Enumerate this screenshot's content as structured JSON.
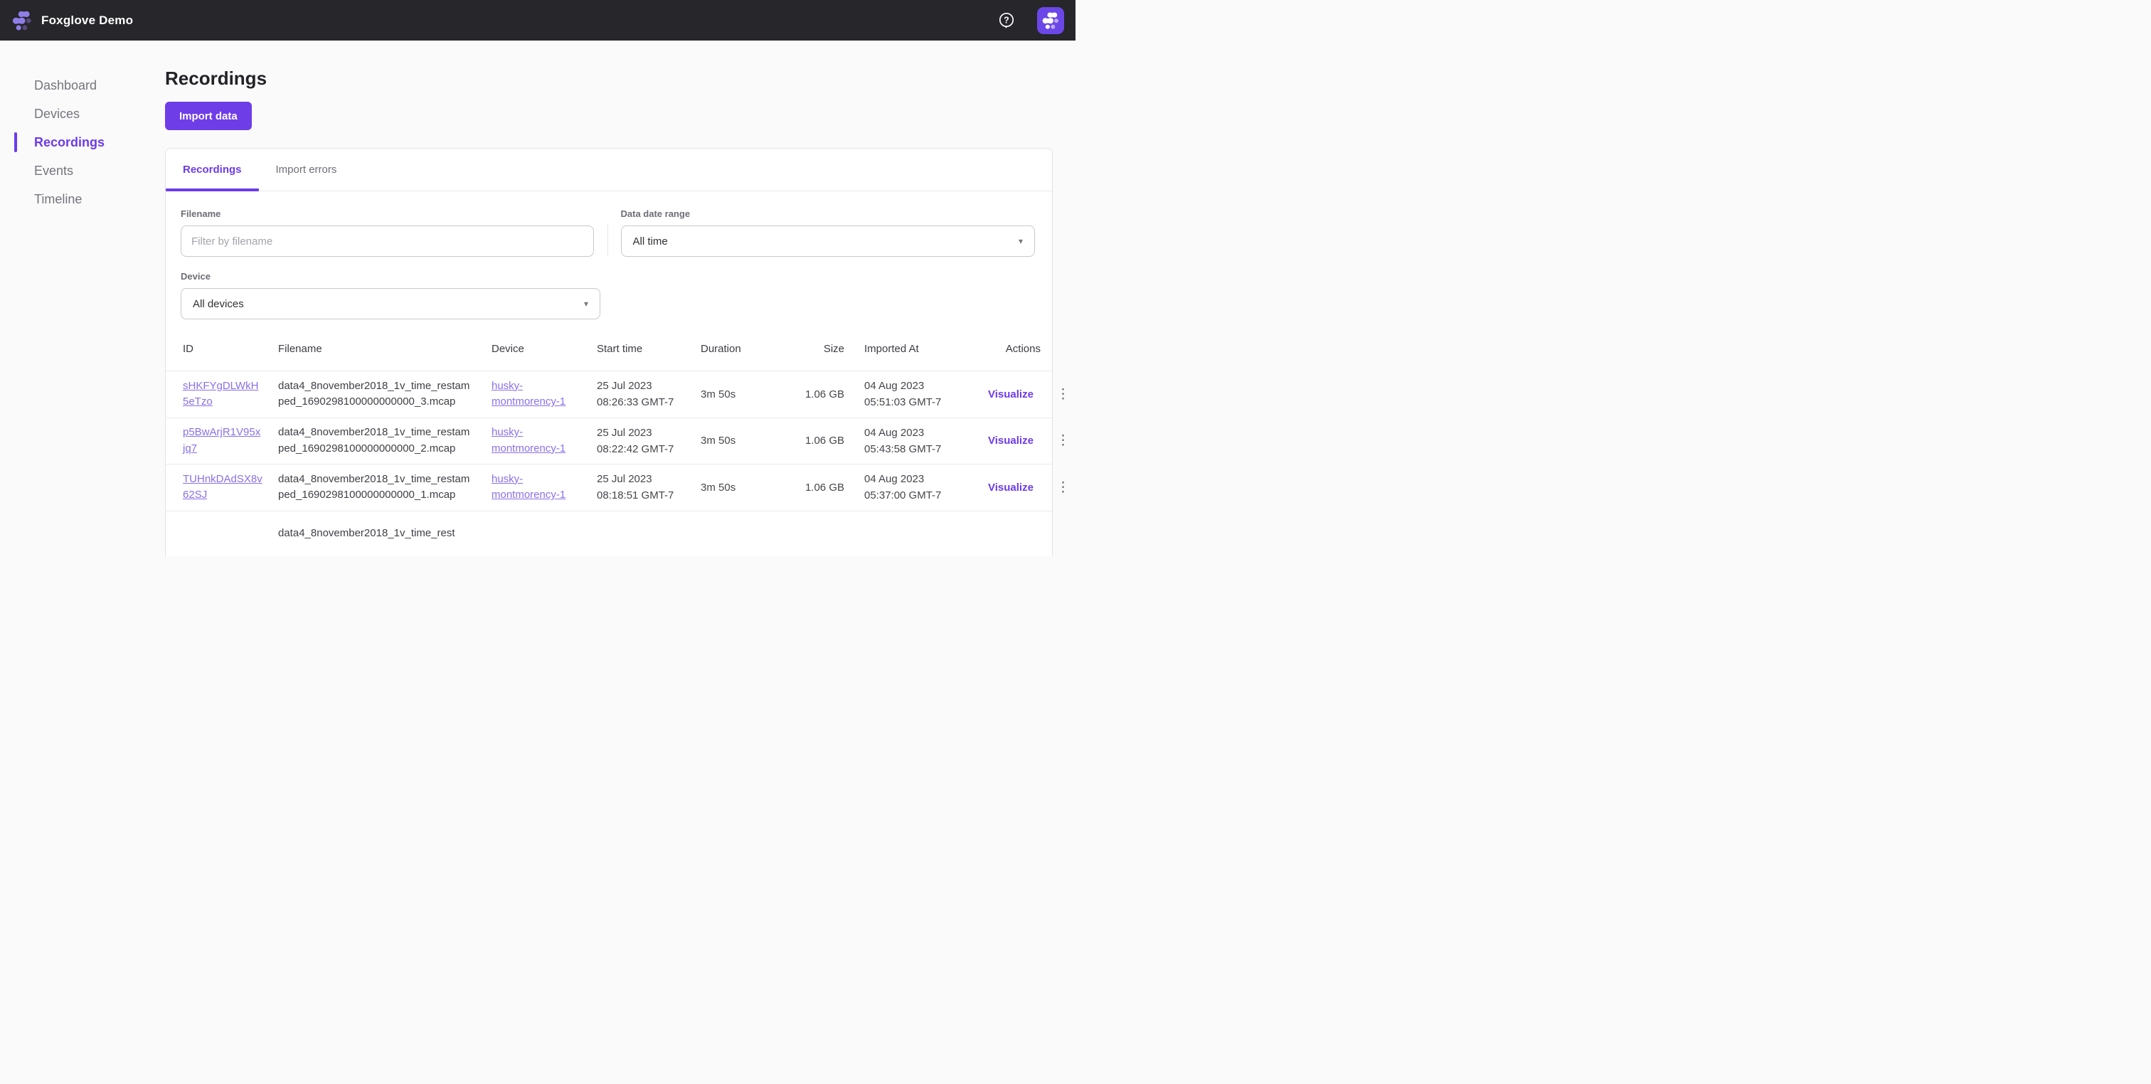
{
  "topbar": {
    "app_title": "Foxglove Demo"
  },
  "icons": {
    "help": "?",
    "caret_down": "▾",
    "kebab": "⋮"
  },
  "colors": {
    "topbar_bg": "#26262b",
    "accent_purple": "#6c3beb",
    "button_purple": "#6e3de8",
    "link_purple": "#8a70ea",
    "avatar_bg": "#6c47e8"
  },
  "sidebar": {
    "items": [
      {
        "label": "Dashboard",
        "active": false
      },
      {
        "label": "Devices",
        "active": false
      },
      {
        "label": "Recordings",
        "active": true
      },
      {
        "label": "Events",
        "active": false
      },
      {
        "label": "Timeline",
        "active": false
      }
    ]
  },
  "page": {
    "title": "Recordings",
    "import_button": "Import data"
  },
  "tabs": [
    {
      "label": "Recordings",
      "active": true
    },
    {
      "label": "Import errors",
      "active": false
    }
  ],
  "filters": {
    "filename": {
      "label": "Filename",
      "placeholder": "Filter by filename",
      "value": ""
    },
    "date_range": {
      "label": "Data date range",
      "value": "All time"
    },
    "device": {
      "label": "Device",
      "value": "All devices"
    }
  },
  "table": {
    "columns": [
      "ID",
      "Filename",
      "Device",
      "Start time",
      "Duration",
      "Size",
      "Imported At",
      "Actions"
    ],
    "visualize_label": "Visualize",
    "rows": [
      {
        "id": "sHKFYgDLWkH5eTzo",
        "filename": "data4_8november2018_1v_time_restamped_1690298100000000000_3.mcap",
        "device": "husky-montmorency-1",
        "start_time": "25 Jul 2023 08:26:33 GMT-7",
        "duration": "3m 50s",
        "size": "1.06 GB",
        "imported_at": "04 Aug 2023 05:51:03 GMT-7"
      },
      {
        "id": "p5BwArjR1V95xjq7",
        "filename": "data4_8november2018_1v_time_restamped_1690298100000000000_2.mcap",
        "device": "husky-montmorency-1",
        "start_time": "25 Jul 2023 08:22:42 GMT-7",
        "duration": "3m 50s",
        "size": "1.06 GB",
        "imported_at": "04 Aug 2023 05:43:58 GMT-7"
      },
      {
        "id": "TUHnkDAdSX8v62SJ",
        "filename": "data4_8november2018_1v_time_restamped_1690298100000000000_1.mcap",
        "device": "husky-montmorency-1",
        "start_time": "25 Jul 2023 08:18:51 GMT-7",
        "duration": "3m 50s",
        "size": "1.06 GB",
        "imported_at": "04 Aug 2023 05:37:00 GMT-7"
      },
      {
        "id": "",
        "filename": "data4_8november2018_1v_time_rest",
        "device": "",
        "start_time": "",
        "duration": "",
        "size": "",
        "imported_at": ""
      }
    ]
  }
}
